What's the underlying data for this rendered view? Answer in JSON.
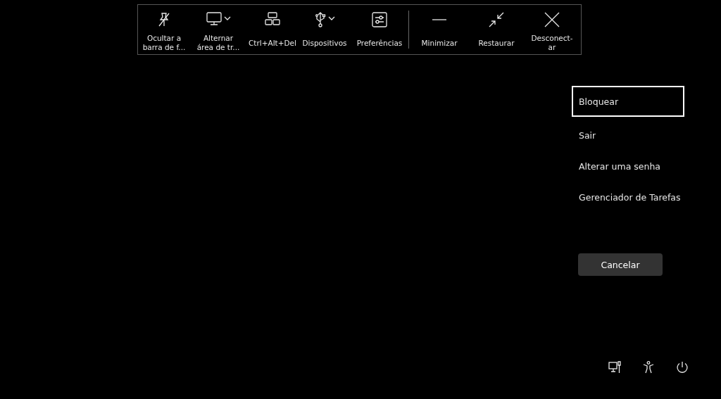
{
  "toolbar": {
    "tools": [
      {
        "kind": "pin",
        "label": "Ocultar a barra de f...",
        "dropdown": false
      },
      {
        "kind": "monitor",
        "label": "Alternar área de tr...",
        "dropdown": true
      },
      {
        "kind": "keys",
        "label": "Ctrl+Alt+Del",
        "dropdown": false
      },
      {
        "kind": "usb",
        "label": "Dispositivos",
        "dropdown": true
      },
      {
        "kind": "sliders",
        "label": "Preferências",
        "dropdown": false
      }
    ],
    "window_controls": [
      {
        "kind": "minimize",
        "label": "Minimizar"
      },
      {
        "kind": "restore",
        "label": "Restaurar"
      },
      {
        "kind": "close",
        "label": "Desconect-ar"
      }
    ]
  },
  "menu": {
    "items": [
      {
        "label": "Bloquear",
        "selected": true
      },
      {
        "label": "Sair",
        "selected": false
      },
      {
        "label": "Alterar uma senha",
        "selected": false
      },
      {
        "label": "Gerenciador de Tarefas",
        "selected": false
      }
    ],
    "cancel": "Cancelar"
  }
}
